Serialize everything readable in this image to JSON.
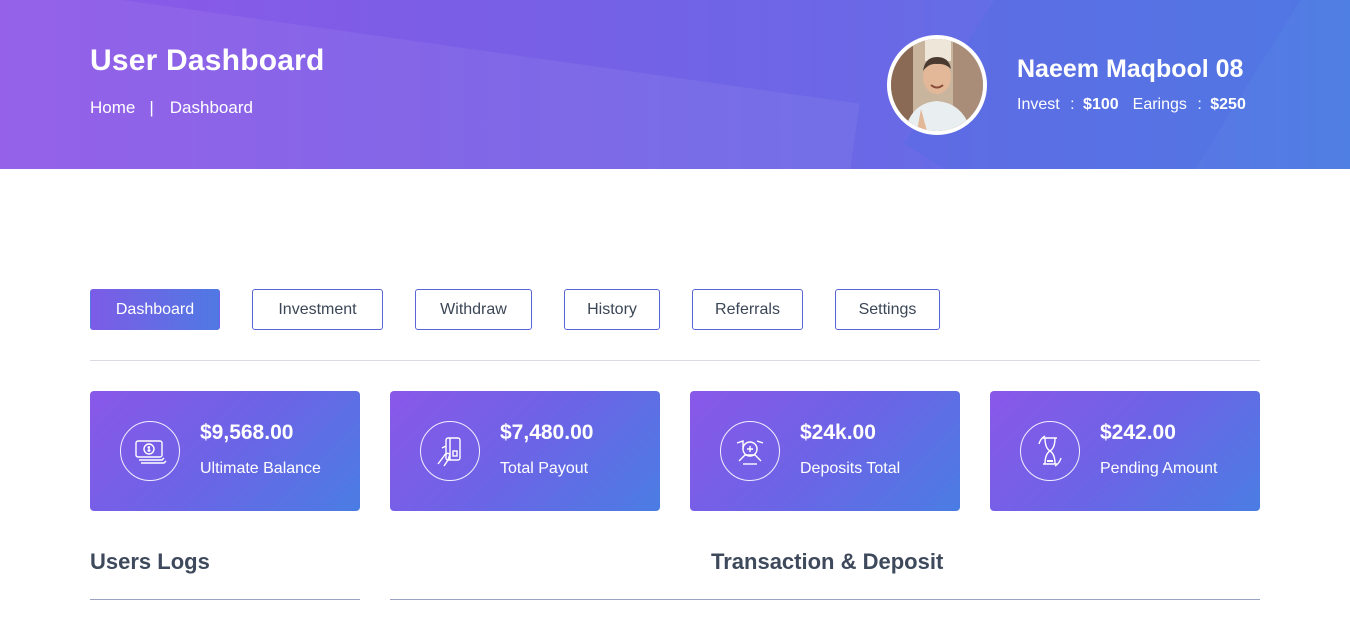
{
  "header": {
    "title": "User Dashboard",
    "breadcrumb": {
      "home": "Home",
      "separator": "|",
      "current": "Dashboard"
    },
    "profile": {
      "name": "Naeem Maqbool 08",
      "invest_label": "Invest",
      "invest_value": "$100",
      "earnings_label": "Earings",
      "earnings_value": "$250",
      "colon": ":"
    }
  },
  "tabs": [
    "Dashboard",
    "Investment",
    "Withdraw",
    "History",
    "Referrals",
    "Settings"
  ],
  "active_tab": "Dashboard",
  "cards": [
    {
      "amount": "$9,568.00",
      "label": "Ultimate Balance",
      "icon": "money-bills-icon"
    },
    {
      "amount": "$7,480.00",
      "label": "Total Payout",
      "icon": "card-in-hand-icon"
    },
    {
      "amount": "$24k.00",
      "label": "Deposits Total",
      "icon": "coin-deposit-icon"
    },
    {
      "amount": "$242.00",
      "label": "Pending Amount",
      "icon": "hourglass-icon"
    }
  ],
  "sections": {
    "users_logs": "Users Logs",
    "transactions": "Transaction & Deposit"
  },
  "colors": {
    "gradient_start": "#8f58e8",
    "gradient_end": "#4f7fe3",
    "tab_border": "#5a66d8",
    "heading_text": "#3e4a5c"
  }
}
